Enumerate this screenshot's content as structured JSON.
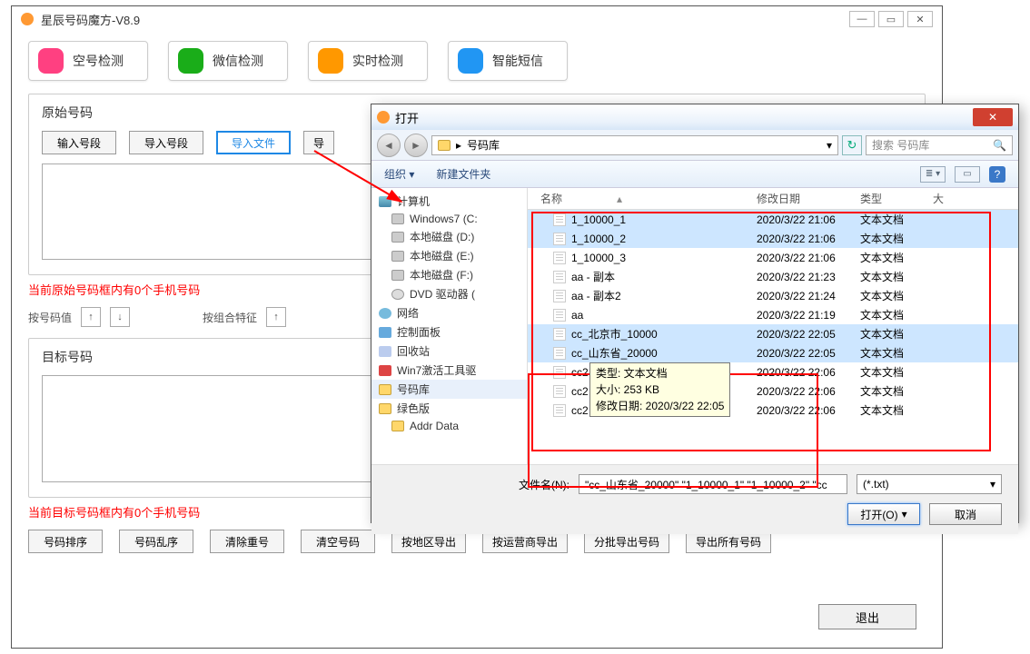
{
  "app": {
    "title": "星辰号码魔方-V8.9",
    "top_buttons": [
      "空号检测",
      "微信检测",
      "实时检测",
      "智能短信"
    ],
    "section1_title": "原始号码",
    "section1_btns": [
      "输入号段",
      "导入号段",
      "导入文件",
      "导"
    ],
    "status1": "当前原始号码框内有0个手机号码",
    "mid_label1": "按号码值",
    "mid_label2": "按组合特征",
    "section2_title": "目标号码",
    "status2": "当前目标号码框内有0个手机号码",
    "bottom_btns": [
      "号码排序",
      "号码乱序",
      "清除重号",
      "清空号码",
      "按地区导出",
      "按运营商导出",
      "分批导出号码",
      "导出所有号码"
    ],
    "exit": "退出"
  },
  "dialog": {
    "title": "打开",
    "breadcrumb": "号码库",
    "search_placeholder": "搜索 号码库",
    "toolbar": {
      "organize": "组织 ▾",
      "newfolder": "新建文件夹"
    },
    "tree": [
      {
        "label": "计算机",
        "icon": "ti-comp",
        "lvl": 0
      },
      {
        "label": "Windows7 (C:",
        "icon": "ti-drive",
        "lvl": 1
      },
      {
        "label": "本地磁盘 (D:)",
        "icon": "ti-drive",
        "lvl": 1
      },
      {
        "label": "本地磁盘 (E:)",
        "icon": "ti-drive",
        "lvl": 1
      },
      {
        "label": "本地磁盘 (F:)",
        "icon": "ti-drive",
        "lvl": 1
      },
      {
        "label": "DVD 驱动器 (",
        "icon": "ti-dvd",
        "lvl": 1
      },
      {
        "label": "网络",
        "icon": "ti-net",
        "lvl": 0
      },
      {
        "label": "控制面板",
        "icon": "ti-ctrl",
        "lvl": 0
      },
      {
        "label": "回收站",
        "icon": "ti-bin",
        "lvl": 0
      },
      {
        "label": "Win7激活工具驱",
        "icon": "ti-app",
        "lvl": 0
      },
      {
        "label": "号码库",
        "icon": "ti-fold",
        "lvl": 0,
        "sel": true
      },
      {
        "label": "绿色版",
        "icon": "ti-fold",
        "lvl": 0
      },
      {
        "label": "Addr Data",
        "icon": "ti-fold",
        "lvl": 1
      }
    ],
    "columns": {
      "name": "名称",
      "date": "修改日期",
      "type": "类型",
      "size": "大"
    },
    "files": [
      {
        "name": "1_10000_1",
        "date": "2020/3/22 21:06",
        "type": "文本文档",
        "sel": true
      },
      {
        "name": "1_10000_2",
        "date": "2020/3/22 21:06",
        "type": "文本文档",
        "sel": true
      },
      {
        "name": "1_10000_3",
        "date": "2020/3/22 21:06",
        "type": "文本文档",
        "sel": false
      },
      {
        "name": "aa - 副本",
        "date": "2020/3/22 21:23",
        "type": "文本文档",
        "sel": false
      },
      {
        "name": "aa - 副本2",
        "date": "2020/3/22 21:24",
        "type": "文本文档",
        "sel": false
      },
      {
        "name": "aa",
        "date": "2020/3/22 21:19",
        "type": "文本文档",
        "sel": false
      },
      {
        "name": "cc_北京市_10000",
        "date": "2020/3/22 22:05",
        "type": "文本文档",
        "sel": true
      },
      {
        "name": "cc_山东省_20000",
        "date": "2020/3/22 22:05",
        "type": "文本文档",
        "sel": true
      },
      {
        "name": "cc2",
        "date": "2020/3/22 22:06",
        "type": "文本文档",
        "sel": false
      },
      {
        "name": "cc2",
        "date": "2020/3/22 22:06",
        "type": "文本文档",
        "sel": false
      },
      {
        "name": "cc2",
        "date": "2020/3/22 22:06",
        "type": "文本文档",
        "sel": false
      }
    ],
    "tooltip": {
      "l1": "类型: 文本文档",
      "l2": "大小: 253 KB",
      "l3": "修改日期: 2020/3/22 22:05"
    },
    "filename_label": "文件名(N):",
    "filename_value": "\"cc_山东省_20000\" \"1_10000_1\" \"1_10000_2\" \"cc",
    "filter": "(*.txt)",
    "open_btn": "打开(O)",
    "cancel_btn": "取消"
  }
}
